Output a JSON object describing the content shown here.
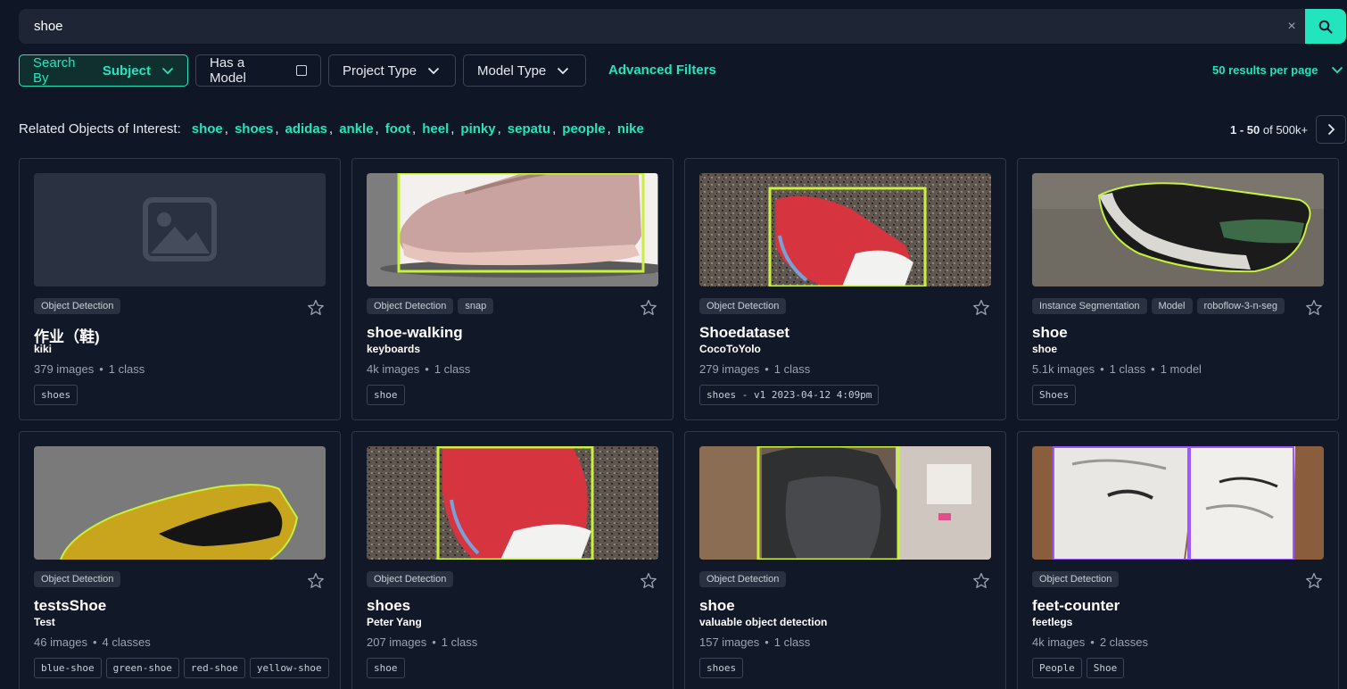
{
  "search": {
    "value": "shoe",
    "clear_label": "×"
  },
  "filters": {
    "search_by_label": "Search By",
    "search_by_value": "Subject",
    "has_model": "Has a Model",
    "project_type": "Project Type",
    "model_type": "Model Type",
    "advanced": "Advanced Filters",
    "per_page": "50 results per page"
  },
  "related": {
    "label": "Related Objects of Interest:",
    "items": [
      "shoe",
      "shoes",
      "adidas",
      "ankle",
      "foot",
      "heel",
      "pinky",
      "sepatu",
      "people",
      "nike"
    ]
  },
  "pagination": {
    "range": "1 - 50",
    "of_text": "of 500k+"
  },
  "colors": {
    "accent": "#23e5bd",
    "background": "#0f1626",
    "annotation": "#c8f03c"
  },
  "cards": [
    {
      "badges": [
        "Object Detection"
      ],
      "title": "作业（鞋)",
      "owner": "kiki",
      "stats": [
        "379 images",
        "1 class"
      ],
      "tags": [
        "shoes"
      ],
      "thumb": "placeholder-image-icon"
    },
    {
      "badges": [
        "Object Detection",
        "snap"
      ],
      "title": "shoe-walking",
      "owner": "keyboards",
      "stats": [
        "4k images",
        "1 class"
      ],
      "tags": [
        "shoe"
      ],
      "thumb": "pink-sneaker"
    },
    {
      "badges": [
        "Object Detection"
      ],
      "title": "Shoedataset",
      "owner": "CocoToYolo",
      "stats": [
        "279 images",
        "1 class"
      ],
      "tags": [
        "shoes - v1 2023-04-12 4:09pm"
      ],
      "thumb": "red-slipon"
    },
    {
      "badges": [
        "Instance Segmentation",
        "Model",
        "roboflow-3-n-seg"
      ],
      "title": "shoe",
      "owner": "shoe",
      "stats": [
        "5.1k images",
        "1 class",
        "1 model"
      ],
      "tags": [
        "Shoes"
      ],
      "thumb": "green-sneaker"
    },
    {
      "badges": [
        "Object Detection"
      ],
      "title": "testsShoe",
      "owner": "Test",
      "stats": [
        "46 images",
        "4 classes"
      ],
      "tags": [
        "blue-shoe",
        "green-shoe",
        "red-shoe",
        "yellow-shoe"
      ],
      "thumb": "yellow-sneaker"
    },
    {
      "badges": [
        "Object Detection"
      ],
      "title": "shoes",
      "owner": "Peter Yang",
      "stats": [
        "207 images",
        "1 class"
      ],
      "tags": [
        "shoe"
      ],
      "thumb": "red-slipon-close"
    },
    {
      "badges": [
        "Object Detection"
      ],
      "title": "shoe",
      "owner": "valuable object detection",
      "stats": [
        "157 images",
        "1 class"
      ],
      "tags": [
        "shoes"
      ],
      "thumb": "black-shoe"
    },
    {
      "badges": [
        "Object Detection"
      ],
      "title": "feet-counter",
      "owner": "feetlegs",
      "stats": [
        "4k images",
        "2 classes"
      ],
      "tags": [
        "People",
        "Shoe"
      ],
      "thumb": "white-nike"
    }
  ]
}
